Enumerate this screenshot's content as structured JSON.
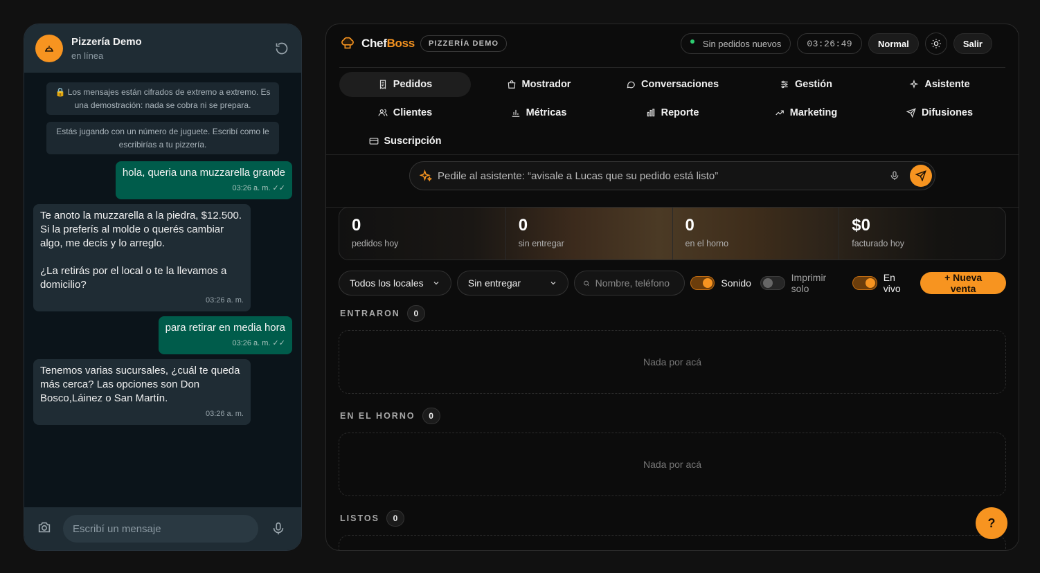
{
  "chat": {
    "name": "Pizzería Demo",
    "status": "en línea",
    "notices": [
      "🔒 Los mensajes están cifrados de extremo a extremo. Es una demostración: nada se cobra ni se prepara.",
      "Estás jugando con un número de juguete. Escribí como le escribirías a tu pizzería."
    ],
    "messages": [
      {
        "dir": "out",
        "text": "hola, queria una muzzarella grande",
        "time": "03:26 a. m. ✓✓"
      },
      {
        "dir": "in",
        "text": "Te anoto la muzzarella a la piedra, $12.500. Si la preferís al molde o querés cambiar algo, me decís y lo arreglo.\n\n¿La retirás por el local o te la llevamos a domicilio?",
        "time": "03:26 a. m."
      },
      {
        "dir": "out",
        "text": "para retirar en media hora",
        "time": "03:26 a. m. ✓✓"
      },
      {
        "dir": "in",
        "text": "Tenemos varias sucursales, ¿cuál te queda más cerca? Las opciones son Don Bosco,Láinez o San Martín.",
        "time": "03:26 a. m."
      }
    ],
    "input_placeholder": "Escribí un mensaje"
  },
  "app": {
    "brand_a": "Chef",
    "brand_b": "Boss",
    "tenant": "PIZZERÍA DEMO",
    "status_pill": "Sin pedidos nuevos",
    "clock": "03:26:49",
    "mode": "Normal",
    "logout": "Salir",
    "nav": [
      {
        "label": "Pedidos",
        "icon": "receipt-icon",
        "active": true
      },
      {
        "label": "Mostrador",
        "icon": "bag-icon"
      },
      {
        "label": "Conversaciones",
        "icon": "chat-bubble-icon"
      },
      {
        "label": "Gestión",
        "icon": "sliders-icon"
      },
      {
        "label": "Asistente",
        "icon": "sparkle-icon"
      },
      {
        "label": "Clientes",
        "icon": "users-icon"
      },
      {
        "label": "Métricas",
        "icon": "bar-chart-icon"
      },
      {
        "label": "Reporte",
        "icon": "report-chart-icon"
      },
      {
        "label": "Marketing",
        "icon": "trend-up-icon"
      },
      {
        "label": "Difusiones",
        "icon": "send-icon"
      },
      {
        "label": "Suscripción",
        "icon": "card-icon"
      }
    ],
    "assistant_placeholder": "Pedile al asistente: “avisale a Lucas que su pedido está listo”",
    "stats": [
      {
        "value": "0",
        "label": "pedidos hoy"
      },
      {
        "value": "0",
        "label": "sin entregar"
      },
      {
        "value": "0",
        "label": "en el horno"
      },
      {
        "value": "$0",
        "label": "facturado hoy"
      }
    ],
    "filters": {
      "location": "Todos los locales",
      "state": "Sin entregar",
      "search_placeholder": "Nombre, teléfono",
      "sound_label": "Sonido",
      "print_label": "Imprimir solo",
      "live_label": "En vivo",
      "new_sale": "+ Nueva venta"
    },
    "sections": [
      {
        "title": "ENTRARON",
        "count": "0",
        "empty": "Nada por acá"
      },
      {
        "title": "EN EL HORNO",
        "count": "0",
        "empty": "Nada por acá"
      },
      {
        "title": "LISTOS",
        "count": "0"
      }
    ],
    "help": "?"
  }
}
